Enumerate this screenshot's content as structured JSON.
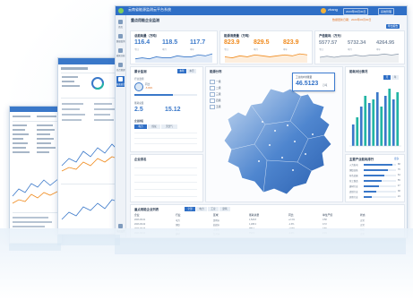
{
  "header": {
    "title": "云南省能源监测云平台系统",
    "user": "zhang",
    "date_button": "2023年06月30日",
    "admin_button": "系统管理"
  },
  "sidebar": {
    "items": [
      {
        "label": "首页",
        "active": false
      },
      {
        "label": "数据监测",
        "active": false
      },
      {
        "label": "能耗分析",
        "active": false
      },
      {
        "label": "综合管理",
        "active": false
      },
      {
        "label": "报表统计",
        "active": true
      },
      {
        "label": "系统设置",
        "active": false
      }
    ]
  },
  "page": {
    "title": "重点用能企业监测",
    "update_note": "数据更新日期：2023年06月30日",
    "export_button": "导出报告"
  },
  "kpi_cards": [
    {
      "title": "总能耗量（万吨）",
      "values": [
        "116.4",
        "118.5",
        "117.7"
      ],
      "labels": [
        "今日",
        "本月",
        "本年"
      ],
      "color": "#3a78c9",
      "spark": [
        3,
        4,
        3,
        5,
        4,
        4,
        6,
        5,
        5,
        7,
        6,
        8
      ]
    },
    {
      "title": "能源消费量（万吨）",
      "values": [
        "823.9",
        "829.5",
        "823.9"
      ],
      "labels": [
        "今日",
        "本月",
        "本年"
      ],
      "color": "#f08a1c",
      "spark": [
        5,
        4,
        6,
        5,
        7,
        6,
        5,
        6,
        7,
        6,
        8,
        7
      ]
    },
    {
      "title": "产值能耗（万元）",
      "values": [
        "5577.57",
        "5732.34",
        "4264.95"
      ],
      "labels": [
        "今日",
        "本月",
        "本年"
      ],
      "color": "#8a99ab",
      "spark": [
        4,
        5,
        4,
        5,
        5,
        6,
        5,
        6,
        6,
        7,
        6,
        7
      ]
    }
  ],
  "left_panel": {
    "title": "累计监测",
    "tabs": [
      "本年",
      "本月"
    ],
    "sub_title": "行业监测",
    "metric_title": "能耗总量",
    "metric_value": "2.5",
    "metric_value2": "15.12",
    "compare_title": "同比",
    "compare_value": "-5.09%",
    "table_title": "企业排名",
    "mini_tabs": [
      "电力",
      "煤炭",
      "天然气"
    ]
  },
  "map": {
    "title": "能源分布",
    "legend": [
      "一级",
      "二级",
      "三级",
      "四级",
      "五级"
    ],
    "tooltip_title": "工业用户用能量",
    "tooltip_value": "46.5123",
    "tooltip_unit": "万吨"
  },
  "right_panel": {
    "title": "能耗对比情况",
    "tabs": [
      "月",
      "年"
    ],
    "bars": [
      6,
      8,
      11,
      14,
      12,
      13,
      15,
      11,
      14,
      16,
      13,
      15
    ],
    "rank_title": "主要产业能耗排行",
    "rank_tab": "更多",
    "ranks": [
      {
        "name": "火力发电",
        "value": 88
      },
      {
        "name": "钢铁冶炼",
        "value": 76
      },
      {
        "name": "有色金属",
        "value": 64
      },
      {
        "name": "化工制造",
        "value": 55
      },
      {
        "name": "建材行业",
        "value": 47
      },
      {
        "name": "造纸行业",
        "value": 38
      },
      {
        "name": "其他行业",
        "value": 24
      }
    ]
  },
  "table": {
    "title": "重点用能企业列表",
    "tabs": [
      "全部",
      "电力",
      "工业",
      "建筑"
    ],
    "headers": [
      "企业",
      "行业",
      "区域",
      "能耗总量",
      "同比",
      "单位产值",
      "状态"
    ],
    "rows": [
      [
        "2023-06-01",
        "电力",
        "昆明市",
        "1,523.8",
        "+2.1%",
        "0.58",
        "正常"
      ],
      [
        "2023-06-02",
        "钢铁",
        "曲靖市",
        "1,208.4",
        "-1.3%",
        "0.72",
        "正常"
      ],
      [
        "2023-06-03",
        "化工",
        "玉溪市",
        "986.2",
        "+0.8%",
        "0.66",
        "预警"
      ],
      [
        "2023-06-04",
        "建材",
        "红河州",
        "754.9",
        "-2.6%",
        "0.49",
        "正常"
      ],
      [
        "2023-06-05",
        "有色",
        "大理州",
        "632.1",
        "+1.7%",
        "0.61",
        "正常"
      ]
    ]
  },
  "colors": {
    "brand": "#2f6fc6",
    "accent": "#f08a1c",
    "map_dark": "#2e64b8",
    "map_light": "#b8d0ee"
  }
}
